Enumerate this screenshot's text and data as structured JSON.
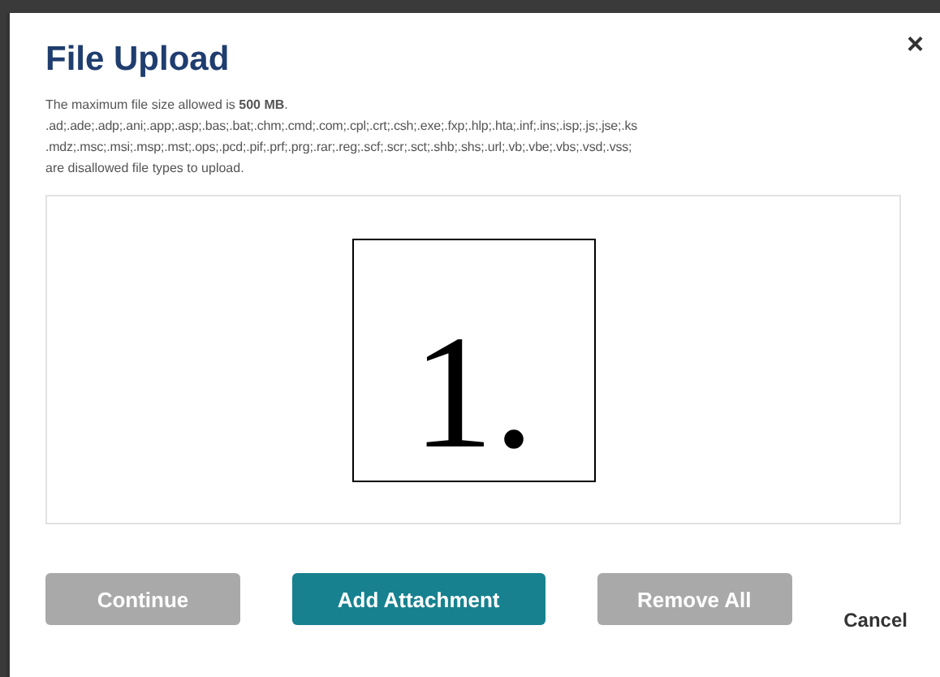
{
  "dialog": {
    "title": "File Upload",
    "close": "×",
    "size_note": "The maximum file size allowed is **500 MB**.",
    "disallowed_types": [
      ".ad;.ade;.adp;.ani;.app;.asp;.bas;.bat;.chm;.cmd;.com;.cpl;.crt;.csh;.exe;.fxp;.hlp;.hta;.inf;.ins;.isp;.js;.jse;.ks",
      ".mdz;.msc;.msi;.msp;.mst;.ops;.pcd;.pif;.prf;.prg;.rar;.reg;.scf;.scr;.sct;.shb;.shs;.url;.vb;.vbe;.vbs;.vsd;.vss;"
    ],
    "disallowed_note": "are disallowed file types to upload.",
    "drop_zone": {
      "callout": "1."
    },
    "buttons": [
      {
        "label": "Continue",
        "kind": "secondary",
        "disabled": true
      },
      {
        "label": "Add Attachment",
        "kind": "primary",
        "disabled": false
      },
      {
        "label": "Remove All",
        "kind": "secondary",
        "disabled": true
      },
      {
        "label": "Cancel",
        "kind": "link",
        "disabled": false
      }
    ]
  }
}
